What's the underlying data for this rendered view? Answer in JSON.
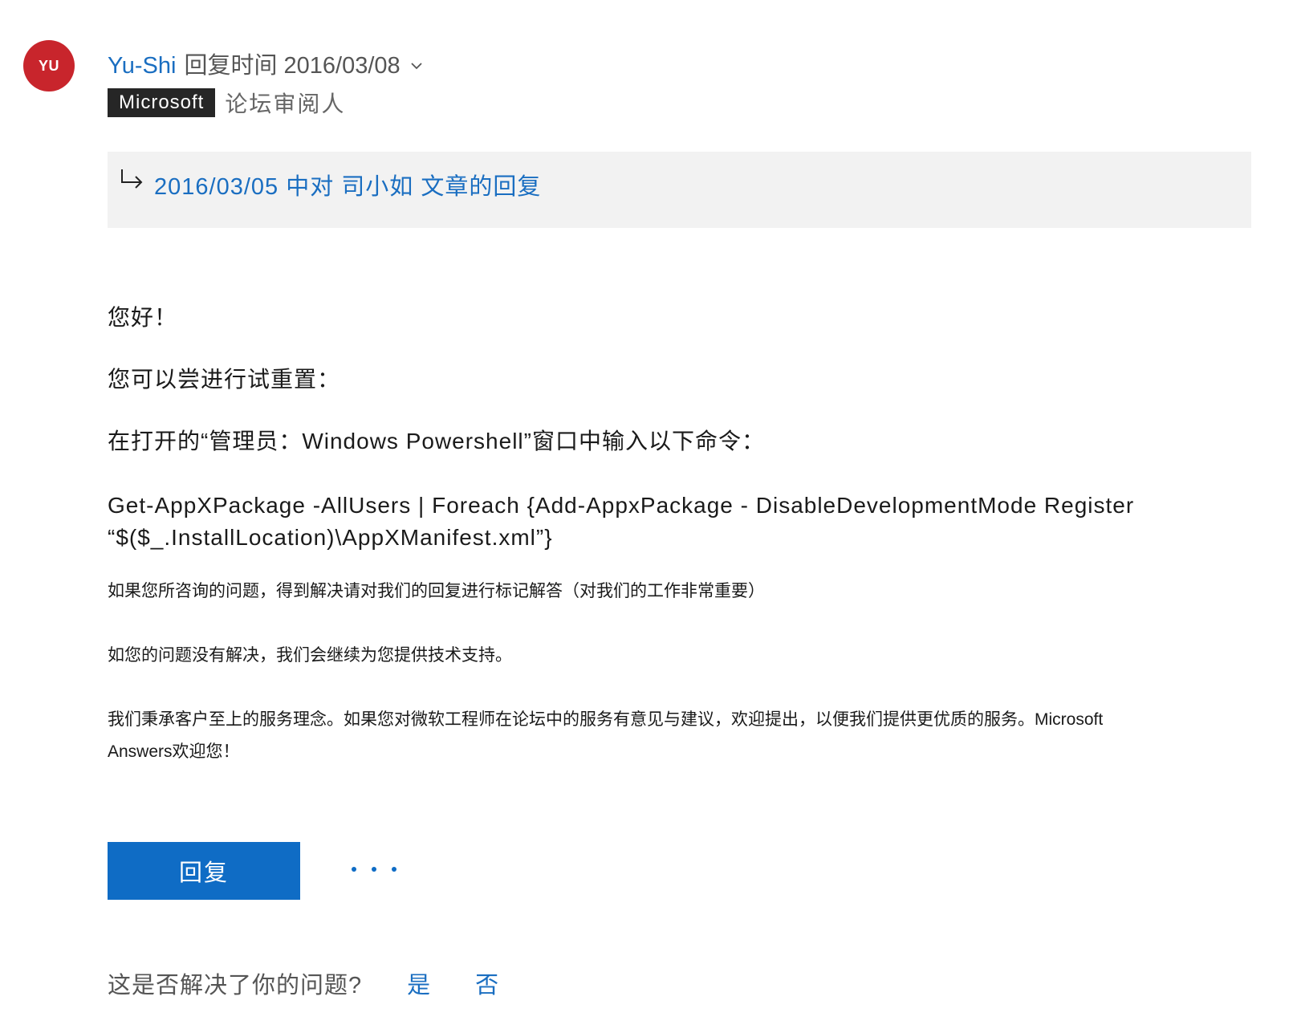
{
  "author": {
    "avatar_initials": "YU",
    "avatar_color": "#c8252c",
    "name": "Yu-Shi",
    "reply_time": "回复时间 2016/03/08",
    "badge": "Microsoft",
    "role": "论坛审阅人"
  },
  "quote": {
    "icon": "reply-arrow-icon",
    "link_text": "2016/03/05 中对 司小如 文章的回复"
  },
  "body": {
    "greeting": "您好！",
    "line1": "您可以尝进行试重置：",
    "line2": "在打开的“管理员：Windows Powershell”窗口中输入以下命令：",
    "command_line1": "Get-AppXPackage -AllUsers | Foreach {Add-AppxPackage - DisableDevelopmentMode Register",
    "command_line2": "“$($_.InstallLocation)\\AppXManifest.xml”}",
    "note1": "如果您所咨询的问题，得到解决请对我们的回复进行标记解答（对我们的工作非常重要）",
    "note2": "如您的问题没有解决，我们会继续为您提供技术支持。",
    "note3_line1": "我们秉承客户至上的服务理念。如果您对微软工程师在论坛中的服务有意见与建议，欢迎提出，以便我们提供更优质的服务。Microsoft",
    "note3_line2": "Answers欢迎您！"
  },
  "actions": {
    "reply_label": "回复",
    "more_icon": "more-dots-icon"
  },
  "feedback": {
    "question": "这是否解决了你的问题?",
    "yes": "是",
    "no": "否"
  },
  "colors": {
    "link": "#1a6ec1",
    "button": "#0f6cc5",
    "badge": "#262626",
    "quote_bg": "#f2f2f2"
  }
}
